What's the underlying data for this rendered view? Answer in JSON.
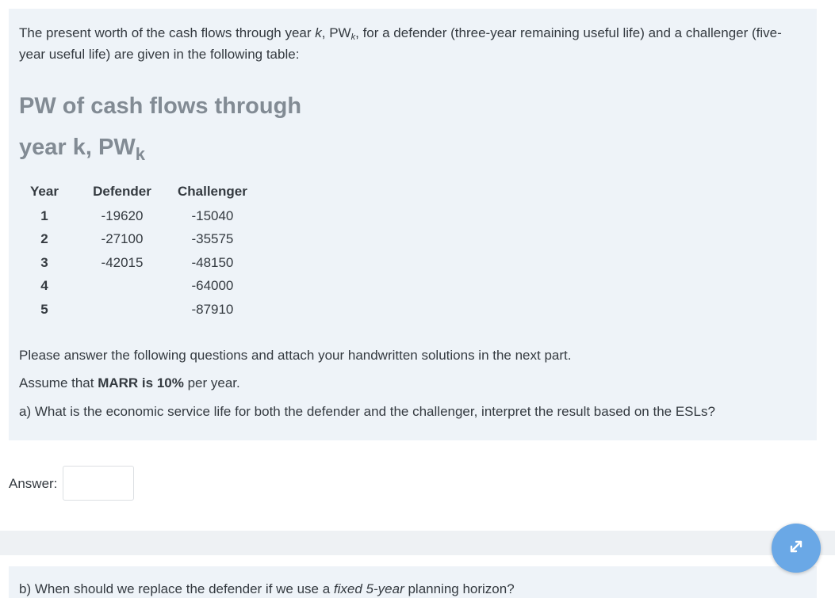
{
  "question_a": {
    "intro_prefix": "The present worth of the cash flows through year ",
    "intro_k": "k",
    "intro_mid": ", PW",
    "intro_sub": "k",
    "intro_comma": ",",
    "intro_suffix": " for a defender (three-year remaining useful life) and a challenger (five-year useful life) are given in the following table:",
    "heading_line1": "PW of cash flows through",
    "heading_line2": "year k, PW",
    "heading_sub": "k",
    "table": {
      "headers": [
        "Year",
        "Defender",
        "Challenger"
      ],
      "rows": [
        [
          "1",
          "-19620",
          "-15040"
        ],
        [
          "2",
          "-27100",
          "-35575"
        ],
        [
          "3",
          "-42015",
          "-48150"
        ],
        [
          "4",
          "",
          "-64000"
        ],
        [
          "5",
          "",
          "-87910"
        ]
      ]
    },
    "instructions": "Please answer the following questions and attach your handwritten solutions in the next part.",
    "assume_prefix": "Assume that ",
    "assume_bold": "MARR is 10%",
    "assume_suffix": " per year.",
    "question": "a) What is the economic service life for both the defender and the challenger, interpret the result based on the ESLs?",
    "answer_label": "Answer:",
    "answer_value": ""
  },
  "question_b": {
    "prefix": "b) When should we replace the defender if we use a ",
    "italic": "fixed 5-year",
    "suffix": " planning horizon?"
  },
  "expand_button": {
    "icon": "expand-arrows-icon",
    "color": "#6aa8e6"
  }
}
